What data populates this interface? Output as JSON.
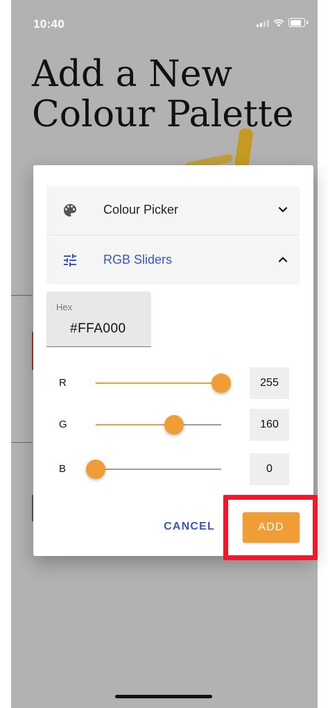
{
  "status_bar": {
    "time": "10:40"
  },
  "page": {
    "title": "Add a New Colour Palette"
  },
  "dialog": {
    "panels": [
      {
        "label": "Colour Picker",
        "icon": "palette-icon",
        "expanded": false
      },
      {
        "label": "RGB Sliders",
        "icon": "tune-icon",
        "expanded": true
      }
    ],
    "hex": {
      "caption": "Hex",
      "value": "#FFA000"
    },
    "sliders": [
      {
        "label": "R",
        "value": "255",
        "fraction": 1.0
      },
      {
        "label": "G",
        "value": "160",
        "fraction": 0.627
      },
      {
        "label": "B",
        "value": "0",
        "fraction": 0.0
      }
    ],
    "actions": {
      "cancel_label": "CANCEL",
      "add_label": "ADD"
    }
  },
  "colors": {
    "accent": "#F19D35",
    "link": "#3C55B8",
    "scrim": "#B2B2B2",
    "highlight": "#F0192B"
  }
}
